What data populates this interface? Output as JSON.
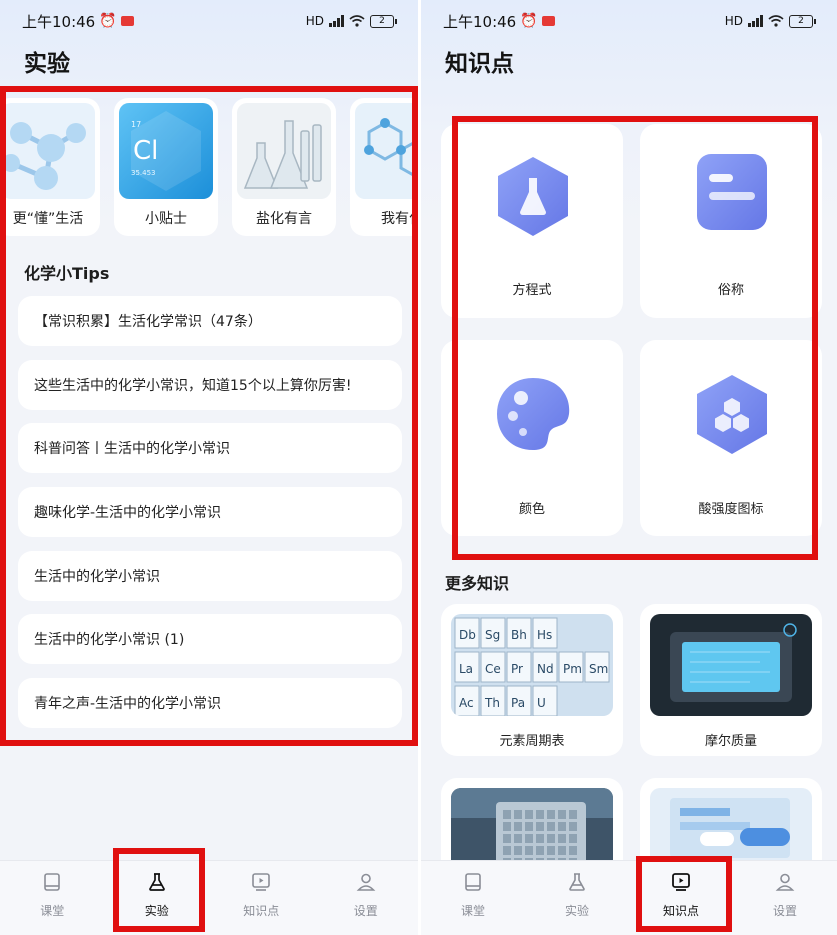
{
  "left_screen": {
    "status_time": "上午10:46",
    "battery": "2",
    "network": "HD",
    "title": "实验",
    "cards": [
      {
        "label": "更“懂”生活",
        "icon": "molecule-image"
      },
      {
        "label": "小贴士",
        "icon": "chlorine-element-image",
        "symbol": "Cl",
        "number": "17",
        "mass": "35.453"
      },
      {
        "label": "盐化有言",
        "icon": "lab-flasks-image"
      },
      {
        "label": "我有化",
        "icon": "molecule-network-image"
      }
    ],
    "tips_title": "化学小Tips",
    "tips": [
      "【常识积累】生活化学常识（47条）",
      "这些生活中的化学小常识，知道15个以上算你厉害!",
      "科普问答丨生活中的化学小常识",
      "趣味化学-生活中的化学小常识",
      "生活中的化学小常识",
      "生活中的化学小常识 (1)",
      "青年之声-生活中的化学小常识"
    ],
    "nav": [
      {
        "label": "课堂",
        "icon": "book-icon",
        "active": false
      },
      {
        "label": "实验",
        "icon": "flask-icon",
        "active": true
      },
      {
        "label": "知识点",
        "icon": "play-screen-icon",
        "active": false
      },
      {
        "label": "设置",
        "icon": "user-icon",
        "active": false
      }
    ]
  },
  "right_screen": {
    "status_time": "上午10:46",
    "battery": "2",
    "network": "HD",
    "title": "知识点",
    "grid": [
      {
        "label": "方程式",
        "icon": "flask-hexagon-icon"
      },
      {
        "label": "俗称",
        "icon": "document-lines-icon"
      },
      {
        "label": "颜色",
        "icon": "palette-icon"
      },
      {
        "label": "酸强度图标",
        "icon": "hexagon-cluster-icon"
      }
    ],
    "more_title": "更多知识",
    "more": [
      {
        "label": "元素周期表",
        "icon": "periodic-table-image",
        "cells": [
          "Db",
          "Sg",
          "Bh",
          "Hs",
          "La",
          "Ce",
          "Pr",
          "Nd",
          "Pm",
          "Sm",
          "Ac",
          "Th",
          "Pa",
          "U"
        ]
      },
      {
        "label": "摩尔质量",
        "icon": "chip-device-image"
      },
      {
        "label": "",
        "icon": "sample-plate-image"
      },
      {
        "label": "",
        "icon": "lab-tray-image"
      }
    ],
    "nav": [
      {
        "label": "课堂",
        "icon": "book-icon",
        "active": false
      },
      {
        "label": "实验",
        "icon": "flask-icon",
        "active": false
      },
      {
        "label": "知识点",
        "icon": "play-screen-icon",
        "active": true
      },
      {
        "label": "设置",
        "icon": "user-icon",
        "active": false
      }
    ]
  },
  "colors": {
    "highlight": "#e01010",
    "accent": "#7b8cf0",
    "background": "#f2f4f9"
  }
}
